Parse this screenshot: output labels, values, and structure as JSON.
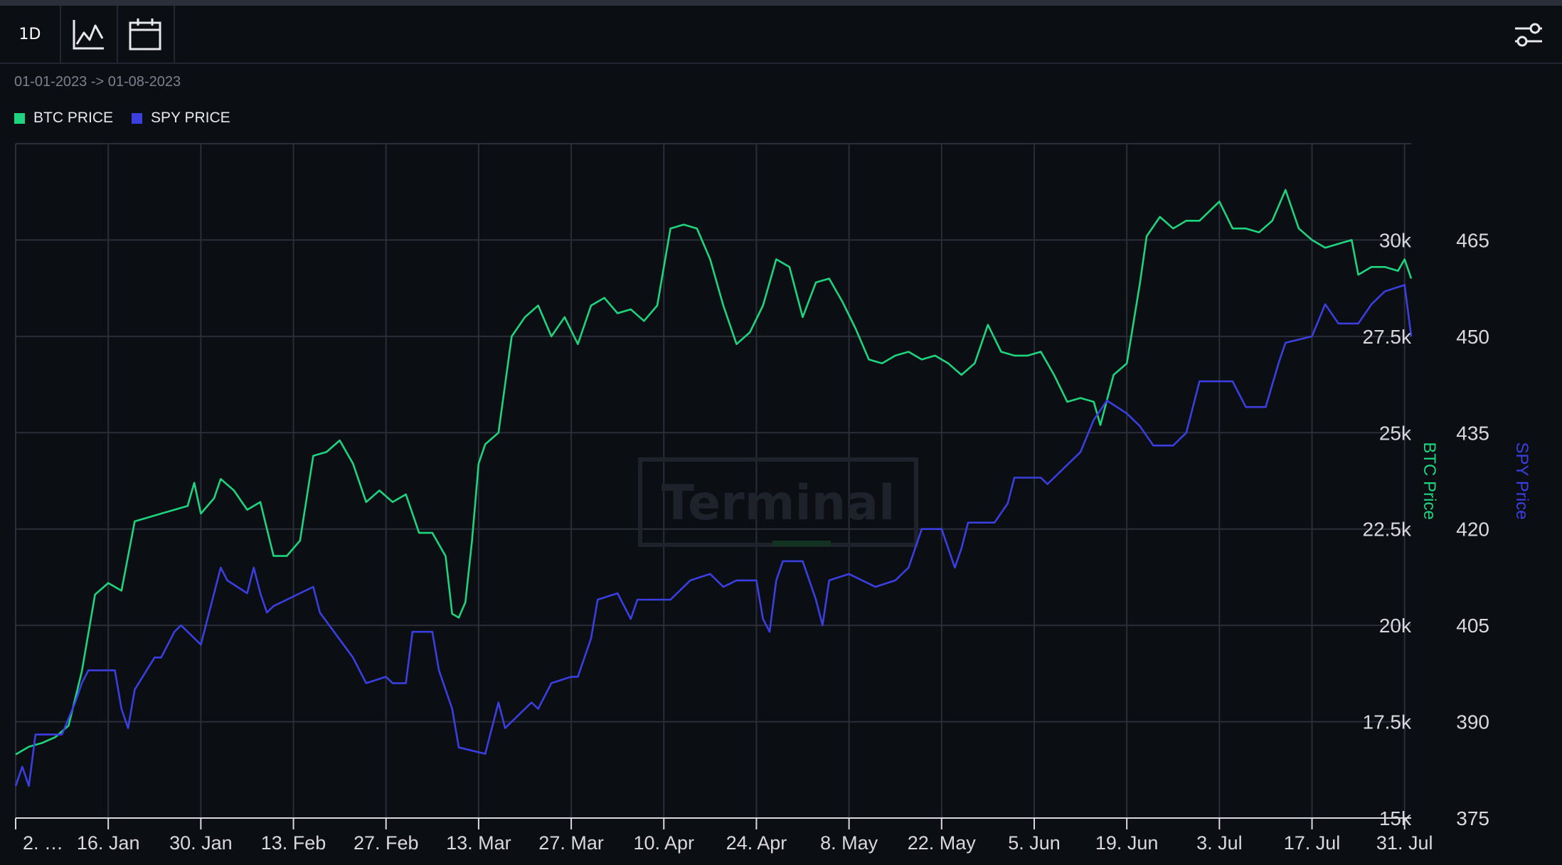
{
  "toolbar": {
    "interval_label": "1D",
    "icons": [
      "line-chart-icon",
      "calendar-icon",
      "settings-sliders-icon"
    ]
  },
  "date_range": "01-01-2023 -> 01-08-2023",
  "watermark": "Terminal",
  "colors": {
    "btc": "#1fd47f",
    "spy": "#3b3fe0",
    "grid": "#2a2e37",
    "background": "#0b0e13"
  },
  "chart_data": {
    "type": "line",
    "legend": [
      {
        "label": "BTC PRICE",
        "color": "#1fd47f"
      },
      {
        "label": "SPY PRICE",
        "color": "#3b3fe0"
      }
    ],
    "x_ticks": [
      "2. …",
      "16. Jan",
      "30. Jan",
      "13. Feb",
      "27. Feb",
      "13. Mar",
      "27. Mar",
      "10. Apr",
      "24. Apr",
      "8. May",
      "22. May",
      "5. Jun",
      "19. Jun",
      "3. Jul",
      "17. Jul",
      "31. Jul"
    ],
    "x_range": [
      "2023-01-02",
      "2023-08-01"
    ],
    "y_left": {
      "label": "BTC Price",
      "ticks": [
        "15k",
        "17.5k",
        "20k",
        "22.5k",
        "25k",
        "27.5k",
        "30k"
      ],
      "range": [
        15000,
        32500
      ]
    },
    "y_right": {
      "label": "SPY Price",
      "ticks": [
        "375",
        "390",
        "405",
        "420",
        "435",
        "450",
        "465"
      ],
      "range": [
        375,
        480
      ]
    },
    "grid": true,
    "series": [
      {
        "name": "BTC PRICE",
        "axis": "left",
        "points": [
          [
            "2023-01-02",
            16650
          ],
          [
            "2023-01-04",
            16850
          ],
          [
            "2023-01-06",
            16950
          ],
          [
            "2023-01-08",
            17100
          ],
          [
            "2023-01-10",
            17400
          ],
          [
            "2023-01-12",
            18800
          ],
          [
            "2023-01-14",
            20800
          ],
          [
            "2023-01-16",
            21100
          ],
          [
            "2023-01-18",
            20900
          ],
          [
            "2023-01-20",
            22700
          ],
          [
            "2023-01-22",
            22800
          ],
          [
            "2023-01-24",
            22900
          ],
          [
            "2023-01-26",
            23000
          ],
          [
            "2023-01-28",
            23100
          ],
          [
            "2023-01-29",
            23700
          ],
          [
            "2023-01-30",
            22900
          ],
          [
            "2023-02-01",
            23300
          ],
          [
            "2023-02-02",
            23800
          ],
          [
            "2023-02-04",
            23500
          ],
          [
            "2023-02-06",
            23000
          ],
          [
            "2023-02-08",
            23200
          ],
          [
            "2023-02-10",
            21800
          ],
          [
            "2023-02-12",
            21800
          ],
          [
            "2023-02-14",
            22200
          ],
          [
            "2023-02-16",
            24400
          ],
          [
            "2023-02-18",
            24500
          ],
          [
            "2023-02-20",
            24800
          ],
          [
            "2023-02-22",
            24200
          ],
          [
            "2023-02-24",
            23200
          ],
          [
            "2023-02-26",
            23500
          ],
          [
            "2023-02-28",
            23200
          ],
          [
            "2023-03-02",
            23400
          ],
          [
            "2023-03-04",
            22400
          ],
          [
            "2023-03-06",
            22400
          ],
          [
            "2023-03-08",
            21800
          ],
          [
            "2023-03-09",
            20300
          ],
          [
            "2023-03-10",
            20200
          ],
          [
            "2023-03-11",
            20600
          ],
          [
            "2023-03-12",
            22200
          ],
          [
            "2023-03-13",
            24200
          ],
          [
            "2023-03-14",
            24700
          ],
          [
            "2023-03-16",
            25000
          ],
          [
            "2023-03-18",
            27500
          ],
          [
            "2023-03-20",
            28000
          ],
          [
            "2023-03-22",
            28300
          ],
          [
            "2023-03-24",
            27500
          ],
          [
            "2023-03-26",
            28000
          ],
          [
            "2023-03-28",
            27300
          ],
          [
            "2023-03-30",
            28300
          ],
          [
            "2023-04-01",
            28500
          ],
          [
            "2023-04-03",
            28100
          ],
          [
            "2023-04-05",
            28200
          ],
          [
            "2023-04-07",
            27900
          ],
          [
            "2023-04-09",
            28300
          ],
          [
            "2023-04-11",
            30300
          ],
          [
            "2023-04-13",
            30400
          ],
          [
            "2023-04-15",
            30300
          ],
          [
            "2023-04-17",
            29500
          ],
          [
            "2023-04-19",
            28300
          ],
          [
            "2023-04-21",
            27300
          ],
          [
            "2023-04-23",
            27600
          ],
          [
            "2023-04-25",
            28300
          ],
          [
            "2023-04-27",
            29500
          ],
          [
            "2023-04-29",
            29300
          ],
          [
            "2023-05-01",
            28000
          ],
          [
            "2023-05-03",
            28900
          ],
          [
            "2023-05-05",
            29000
          ],
          [
            "2023-05-07",
            28400
          ],
          [
            "2023-05-09",
            27700
          ],
          [
            "2023-05-11",
            26900
          ],
          [
            "2023-05-13",
            26800
          ],
          [
            "2023-05-15",
            27000
          ],
          [
            "2023-05-17",
            27100
          ],
          [
            "2023-05-19",
            26900
          ],
          [
            "2023-05-21",
            27000
          ],
          [
            "2023-05-23",
            26800
          ],
          [
            "2023-05-25",
            26500
          ],
          [
            "2023-05-27",
            26800
          ],
          [
            "2023-05-29",
            27800
          ],
          [
            "2023-05-31",
            27100
          ],
          [
            "2023-06-02",
            27000
          ],
          [
            "2023-06-04",
            27000
          ],
          [
            "2023-06-06",
            27100
          ],
          [
            "2023-06-08",
            26500
          ],
          [
            "2023-06-10",
            25800
          ],
          [
            "2023-06-12",
            25900
          ],
          [
            "2023-06-14",
            25800
          ],
          [
            "2023-06-15",
            25200
          ],
          [
            "2023-06-17",
            26500
          ],
          [
            "2023-06-19",
            26800
          ],
          [
            "2023-06-21",
            28900
          ],
          [
            "2023-06-22",
            30100
          ],
          [
            "2023-06-24",
            30600
          ],
          [
            "2023-06-26",
            30300
          ],
          [
            "2023-06-28",
            30500
          ],
          [
            "2023-06-30",
            30500
          ],
          [
            "2023-07-03",
            31000
          ],
          [
            "2023-07-05",
            30300
          ],
          [
            "2023-07-07",
            30300
          ],
          [
            "2023-07-09",
            30200
          ],
          [
            "2023-07-11",
            30500
          ],
          [
            "2023-07-13",
            31300
          ],
          [
            "2023-07-15",
            30300
          ],
          [
            "2023-07-17",
            30000
          ],
          [
            "2023-07-19",
            29800
          ],
          [
            "2023-07-21",
            29900
          ],
          [
            "2023-07-23",
            30000
          ],
          [
            "2023-07-24",
            29100
          ],
          [
            "2023-07-26",
            29300
          ],
          [
            "2023-07-28",
            29300
          ],
          [
            "2023-07-30",
            29200
          ],
          [
            "2023-07-31",
            29500
          ],
          [
            "2023-08-01",
            29000
          ]
        ]
      },
      {
        "name": "SPY PRICE",
        "axis": "right",
        "points": [
          [
            "2023-01-02",
            380
          ],
          [
            "2023-01-03",
            383
          ],
          [
            "2023-01-04",
            380
          ],
          [
            "2023-01-05",
            388
          ],
          [
            "2023-01-06",
            388
          ],
          [
            "2023-01-09",
            388
          ],
          [
            "2023-01-11",
            393
          ],
          [
            "2023-01-12",
            396
          ],
          [
            "2023-01-13",
            398
          ],
          [
            "2023-01-16",
            398
          ],
          [
            "2023-01-17",
            398
          ],
          [
            "2023-01-18",
            392
          ],
          [
            "2023-01-19",
            389
          ],
          [
            "2023-01-20",
            395
          ],
          [
            "2023-01-23",
            400
          ],
          [
            "2023-01-24",
            400
          ],
          [
            "2023-01-26",
            404
          ],
          [
            "2023-01-27",
            405
          ],
          [
            "2023-01-30",
            402
          ],
          [
            "2023-01-31",
            406
          ],
          [
            "2023-02-02",
            414
          ],
          [
            "2023-02-03",
            412
          ],
          [
            "2023-02-06",
            410
          ],
          [
            "2023-02-07",
            414
          ],
          [
            "2023-02-08",
            410
          ],
          [
            "2023-02-09",
            407
          ],
          [
            "2023-02-10",
            408
          ],
          [
            "2023-02-14",
            410
          ],
          [
            "2023-02-16",
            411
          ],
          [
            "2023-02-17",
            407
          ],
          [
            "2023-02-22",
            400
          ],
          [
            "2023-02-24",
            396
          ],
          [
            "2023-02-27",
            397
          ],
          [
            "2023-02-28",
            396
          ],
          [
            "2023-03-02",
            396
          ],
          [
            "2023-03-03",
            404
          ],
          [
            "2023-03-06",
            404
          ],
          [
            "2023-03-07",
            398
          ],
          [
            "2023-03-09",
            392
          ],
          [
            "2023-03-10",
            386
          ],
          [
            "2023-03-14",
            385
          ],
          [
            "2023-03-15",
            389
          ],
          [
            "2023-03-16",
            393
          ],
          [
            "2023-03-17",
            389
          ],
          [
            "2023-03-20",
            392
          ],
          [
            "2023-03-21",
            393
          ],
          [
            "2023-03-22",
            392
          ],
          [
            "2023-03-24",
            396
          ],
          [
            "2023-03-27",
            397
          ],
          [
            "2023-03-28",
            397
          ],
          [
            "2023-03-30",
            403
          ],
          [
            "2023-03-31",
            409
          ],
          [
            "2023-04-03",
            410
          ],
          [
            "2023-04-05",
            406
          ],
          [
            "2023-04-06",
            409
          ],
          [
            "2023-04-10",
            409
          ],
          [
            "2023-04-11",
            409
          ],
          [
            "2023-04-14",
            412
          ],
          [
            "2023-04-17",
            413
          ],
          [
            "2023-04-19",
            411
          ],
          [
            "2023-04-21",
            412
          ],
          [
            "2023-04-24",
            412
          ],
          [
            "2023-04-25",
            406
          ],
          [
            "2023-04-26",
            404
          ],
          [
            "2023-04-27",
            412
          ],
          [
            "2023-04-28",
            415
          ],
          [
            "2023-05-01",
            415
          ],
          [
            "2023-05-02",
            412
          ],
          [
            "2023-05-03",
            409
          ],
          [
            "2023-05-04",
            405
          ],
          [
            "2023-05-05",
            412
          ],
          [
            "2023-05-08",
            413
          ],
          [
            "2023-05-10",
            412
          ],
          [
            "2023-05-12",
            411
          ],
          [
            "2023-05-15",
            412
          ],
          [
            "2023-05-17",
            414
          ],
          [
            "2023-05-19",
            420
          ],
          [
            "2023-05-22",
            420
          ],
          [
            "2023-05-24",
            414
          ],
          [
            "2023-05-25",
            417
          ],
          [
            "2023-05-26",
            421
          ],
          [
            "2023-05-30",
            421
          ],
          [
            "2023-06-01",
            424
          ],
          [
            "2023-06-02",
            428
          ],
          [
            "2023-06-06",
            428
          ],
          [
            "2023-06-07",
            427
          ],
          [
            "2023-06-09",
            429
          ],
          [
            "2023-06-12",
            432
          ],
          [
            "2023-06-14",
            437
          ],
          [
            "2023-06-16",
            440
          ],
          [
            "2023-06-19",
            438
          ],
          [
            "2023-06-21",
            436
          ],
          [
            "2023-06-23",
            433
          ],
          [
            "2023-06-26",
            433
          ],
          [
            "2023-06-28",
            435
          ],
          [
            "2023-06-30",
            443
          ],
          [
            "2023-07-03",
            443
          ],
          [
            "2023-07-05",
            443
          ],
          [
            "2023-07-07",
            439
          ],
          [
            "2023-07-10",
            439
          ],
          [
            "2023-07-12",
            446
          ],
          [
            "2023-07-13",
            449
          ],
          [
            "2023-07-17",
            450
          ],
          [
            "2023-07-19",
            455
          ],
          [
            "2023-07-21",
            452
          ],
          [
            "2023-07-24",
            452
          ],
          [
            "2023-07-26",
            455
          ],
          [
            "2023-07-28",
            457
          ],
          [
            "2023-07-31",
            458
          ],
          [
            "2023-08-01",
            450
          ]
        ]
      }
    ]
  }
}
